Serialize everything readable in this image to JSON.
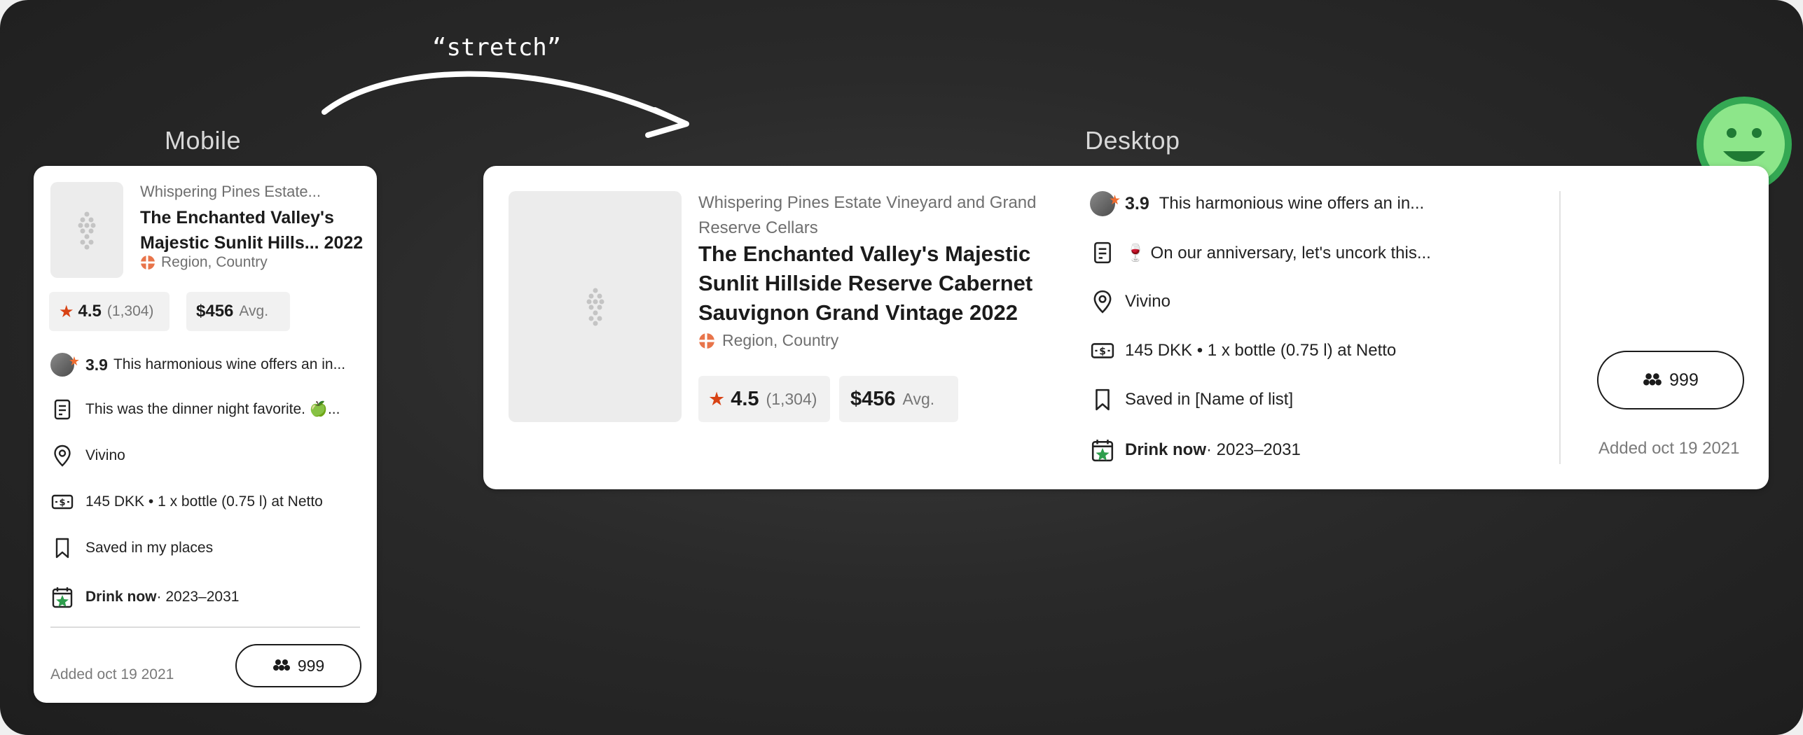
{
  "annotation": {
    "stretch": "“stretch”"
  },
  "headings": {
    "mobile": "Mobile",
    "desktop": "Desktop"
  },
  "mobile": {
    "winery": "Whispering Pines Estate...",
    "wine_name_line1": "The Enchanted Valley's",
    "wine_name_line2": "Majestic Sunlit Hills... 2022",
    "region": "Region, Country",
    "rating": "4.5",
    "rating_count": "(1,304)",
    "price": "$456",
    "price_suffix": "Avg.",
    "review_score": "3.9",
    "review_text": "This harmonious wine offers an in...",
    "note_text": "This was the dinner night favorite. 🍏...",
    "place_text": "Vivino",
    "purchase_text": "145 DKK • 1 x bottle (0.75 l) at Netto",
    "saved_text": "Saved in my places",
    "drink_label": "Drink now",
    "drink_years": " · 2023–2031",
    "added": "Added oct 19 2021",
    "friends_count": "999"
  },
  "desktop": {
    "winery_line1": "Whispering Pines Estate Vineyard and Grand",
    "winery_line2": "Reserve Cellars",
    "wine_name_line1": "The Enchanted Valley's Majestic",
    "wine_name_line2": "Sunlit Hillside Reserve Cabernet",
    "wine_name_line3": "Sauvignon Grand Vintage 2022",
    "region": "Region, Country",
    "rating": "4.5",
    "rating_count": "(1,304)",
    "price": "$456",
    "price_suffix": "Avg.",
    "review_score": "3.9",
    "review_text": "This harmonious wine offers an in...",
    "note_text": "🍷 On our anniversary, let's uncork this...",
    "place_text": "Vivino",
    "purchase_text": "145 DKK • 1 x bottle (0.75 l) at Netto",
    "saved_text": "Saved in [Name of list]",
    "drink_label": "Drink now",
    "drink_years": " · 2023–2031",
    "friends_count": "999",
    "added": "Added oct 19 2021"
  },
  "colors": {
    "accent_star": "#d84315",
    "smiley_ring": "#34a853",
    "smiley_face": "#8de68a",
    "background": "#2a2a2a"
  },
  "icons": [
    "grapes-icon",
    "star-icon",
    "note-icon",
    "location-pin-icon",
    "money-icon",
    "bookmark-icon",
    "calendar-star-icon",
    "friends-icon",
    "region-flag-icon",
    "smiley-icon",
    "arrow-icon"
  ]
}
